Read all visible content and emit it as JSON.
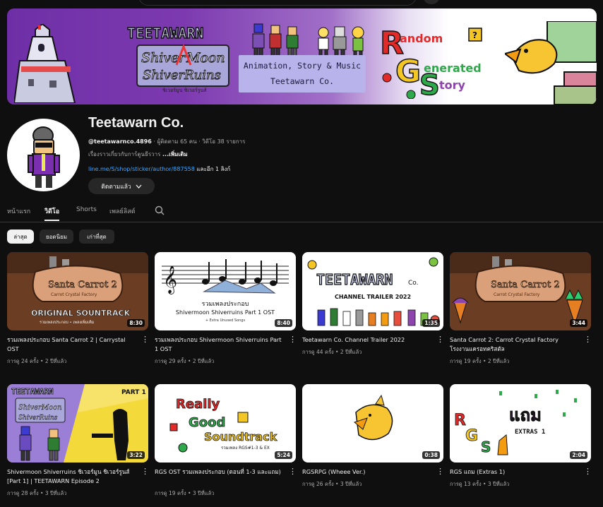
{
  "banner": {
    "tagline_1": "Animation, Story & Music",
    "tagline_2": "Teetawarn Co."
  },
  "channel": {
    "name": "Teetawarn Co.",
    "handle": "@teetawarnco.4896",
    "stats": " · ผู้ติดตาม 65 คน · วิดีโอ 38 รายการ",
    "description": "เรื่องราวเกี่ยวกับการ์ตูนธีรวาร ",
    "more_label": "...เพิ่มเติม",
    "link_url": "line.me/S/shop/sticker/author/887558",
    "link_suffix": " และอีก 1 ลิงก์",
    "subscribe_label": "ติดตามแล้ว"
  },
  "tabs": [
    "หน้าแรก",
    "วิดีโอ",
    "Shorts",
    "เพลย์ลิสต์"
  ],
  "active_tab": "วิดีโอ",
  "chips": [
    "ล่าสุด",
    "ยอดนิยม",
    "เก่าที่สุด"
  ],
  "videos": [
    {
      "title": "รวมเพลงประกอบ Santa Carrot 2 | Carrystal OST",
      "views": "การดู 24 ครั้ง",
      "age": "2 ปีที่แล้ว",
      "duration": "8:30"
    },
    {
      "title": "รวมเพลงประกอบ Shivermoon Shiverruins Part 1 OST",
      "views": "การดู 29 ครั้ง",
      "age": "2 ปีที่แล้ว",
      "duration": "8:40"
    },
    {
      "title": "Teetawarn Co. Channel Trailer 2022",
      "views": "การดู 44 ครั้ง",
      "age": "2 ปีที่แล้ว",
      "duration": "1:35"
    },
    {
      "title": "Santa Carrot 2: Carrot Crystal Factory โรงงานแครอทคริสตัล",
      "views": "การดู 19 ครั้ง",
      "age": "2 ปีที่แล้ว",
      "duration": "3:44"
    },
    {
      "title": "Shivermoon Shiverruins ชิเวอร์มูน ชิเวอร์รูนส์ [Part 1] | TEETAWARN Episode 2",
      "views": "การดู 28 ครั้ง",
      "age": "3 ปีที่แล้ว",
      "duration": "3:22"
    },
    {
      "title": "RGS OST รวมเพลงประกอบ (ตอนที่ 1-3 และแถม)",
      "views": "การดู 19 ครั้ง",
      "age": "3 ปีที่แล้ว",
      "duration": "5:24"
    },
    {
      "title": "RGSRPG (Wheee Ver.)",
      "views": "การดู 26 ครั้ง",
      "age": "3 ปีที่แล้ว",
      "duration": "0:38"
    },
    {
      "title": "RGS แถม (Extras 1)",
      "views": "การดู 13 ครั้ง",
      "age": "3 ปีที่แล้ว",
      "duration": "2:04"
    }
  ],
  "thumb_text": {
    "v1_title1": "Santa Carrot 2",
    "v1_title2": "Carrot Crystal Factory",
    "v1_ost": "ORIGINAL SOUNTRACK",
    "v1_sub": "รวมเพลงประกอบ • เพลงเพิ่มเติม",
    "v2_line1": "รวมเพลงประกอบ",
    "v2_line2": "Shivermoon Shiverruins Part 1 OST",
    "v2_line3": "+ Extra Unused Songs",
    "v3_logo": "TEETAWARN",
    "v3_co": "Co.",
    "v3_sub": "CHANNEL TRAILER 2022",
    "v4_title1": "Santa Carrot 2",
    "v4_title2": "Carrot Crystal Factory",
    "v5_brand": "TEETAWARN",
    "v5_part": "PART 1",
    "v6_w1": "Really",
    "v6_w2": "Good",
    "v6_w3": "Soundtrack",
    "v6_sub": "รวมเพลง RGS#1-3 & EX",
    "v8_word": "แถม",
    "v8_sub": "EXTRAS 1"
  },
  "colors": {
    "background": "#0f0f0f",
    "link": "#3ea6ff",
    "chip_active": "#f1f1f1",
    "chip_inactive": "#272727",
    "secondary_text": "#aaaaaa"
  }
}
